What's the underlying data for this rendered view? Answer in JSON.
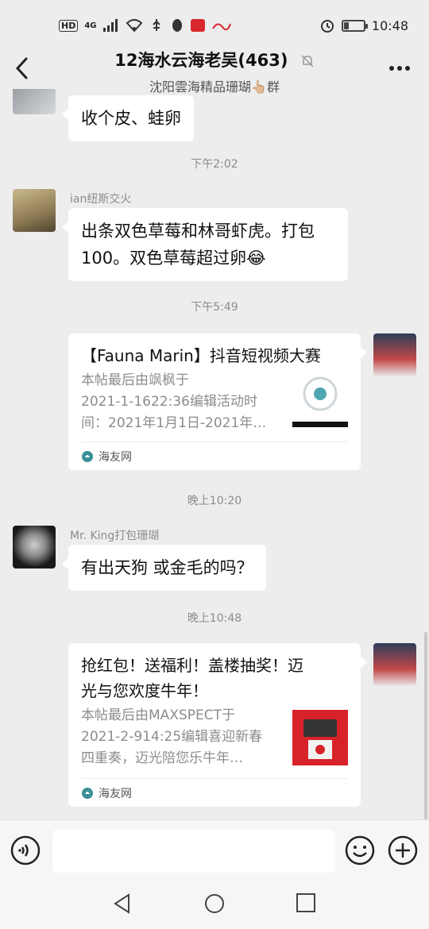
{
  "status_bar": {
    "network_chip": "HD",
    "network_type": "4G",
    "time": "10:48",
    "battery_level": 0.25
  },
  "header": {
    "title": "12海水云海老吴(463)",
    "subtitle": "沈阳雲海精品珊瑚👆🏼群",
    "icons": [
      "back-icon",
      "mute-bell-icon",
      "more-icon"
    ]
  },
  "messages": [
    {
      "type": "text",
      "side": "left",
      "text": "收个皮、蛙卵"
    },
    {
      "type": "time",
      "text": "下午2:02"
    },
    {
      "type": "text",
      "side": "left",
      "sender": "ian纽斯交火",
      "lines": [
        "出条双色草莓和林哥虾虎。打包",
        "100。双色草莓超过卵😂"
      ]
    },
    {
      "type": "time",
      "text": "下午5:49"
    },
    {
      "type": "card",
      "side": "right",
      "title": "【Fauna Marin】抖音短视频大赛",
      "desc_lines": [
        "本帖最后由飒枫于",
        "2021-1-1622:36编辑活动时",
        "间：2021年1月1日-2021年…"
      ],
      "source": "海友网"
    },
    {
      "type": "time",
      "text": "晚上10:20"
    },
    {
      "type": "text",
      "side": "left",
      "sender": "Mr. King打包珊瑚",
      "text": "有出天狗 或金毛的吗？"
    },
    {
      "type": "time",
      "text": "晚上10:48"
    },
    {
      "type": "card",
      "side": "right",
      "title_lines": [
        "抢红包！送福利！盖楼抽奖！迈",
        "光与您欢度牛年！"
      ],
      "desc_lines": [
        "本帖最后由MAXSPECT于",
        "2021-2-914:25编辑喜迎新春",
        "四重奏，迈光陪您乐牛年…"
      ],
      "source": "海友网"
    }
  ],
  "input_bar": {
    "icons": [
      "voice-icon",
      "emoji-icon",
      "plus-icon"
    ],
    "value": ""
  },
  "nav_bar": {
    "icons": [
      "nav-back-icon",
      "nav-home-icon",
      "nav-recent-icon"
    ]
  }
}
